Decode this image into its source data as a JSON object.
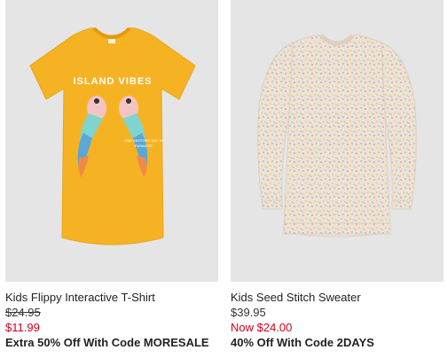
{
  "products": [
    {
      "name": "Kids Flippy Interactive T-Shirt",
      "original_price": "$24.95",
      "sale_price": "$11.99",
      "promo": "Extra 50% Off With Code MORESALE",
      "image_text": [
        "ISLAND VIBES",
        "ONE ANOTHER DAY IN",
        "PARADISE"
      ]
    },
    {
      "name": "Kids Seed Stitch Sweater",
      "regular_price": "$39.95",
      "now_price": "Now $24.00",
      "promo": "40% Off With Code 2DAYS"
    }
  ],
  "colors": {
    "image_bg": "#e5e5e5",
    "sale_red": "#d0021b",
    "tshirt_yellow": "#f5b324",
    "sweater_cream": "#ece2d4"
  }
}
